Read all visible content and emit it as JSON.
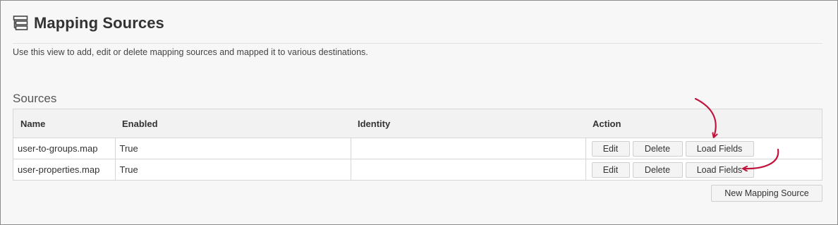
{
  "header": {
    "title": "Mapping Sources",
    "description": "Use this view to add, edit or delete mapping sources and mapped it to various destinations."
  },
  "sources_section": {
    "title": "Sources",
    "columns": [
      "Name",
      "Enabled",
      "Identity",
      "Action"
    ],
    "rows": [
      {
        "name": "user-to-groups.map",
        "enabled": "True",
        "identity": ""
      },
      {
        "name": "user-properties.map",
        "enabled": "True",
        "identity": ""
      }
    ],
    "actions": {
      "edit_label": "Edit",
      "delete_label": "Delete",
      "load_fields_label": "Load Fields"
    },
    "new_source_label": "New Mapping Source"
  },
  "icons": {
    "page_icon": "table-stack-icon",
    "annotation": "red-curved-arrow-icon"
  },
  "colors": {
    "annotation_arrow": "#c0143c",
    "header_bg": "#f2f2f2",
    "page_bg": "#f7f7f7"
  }
}
